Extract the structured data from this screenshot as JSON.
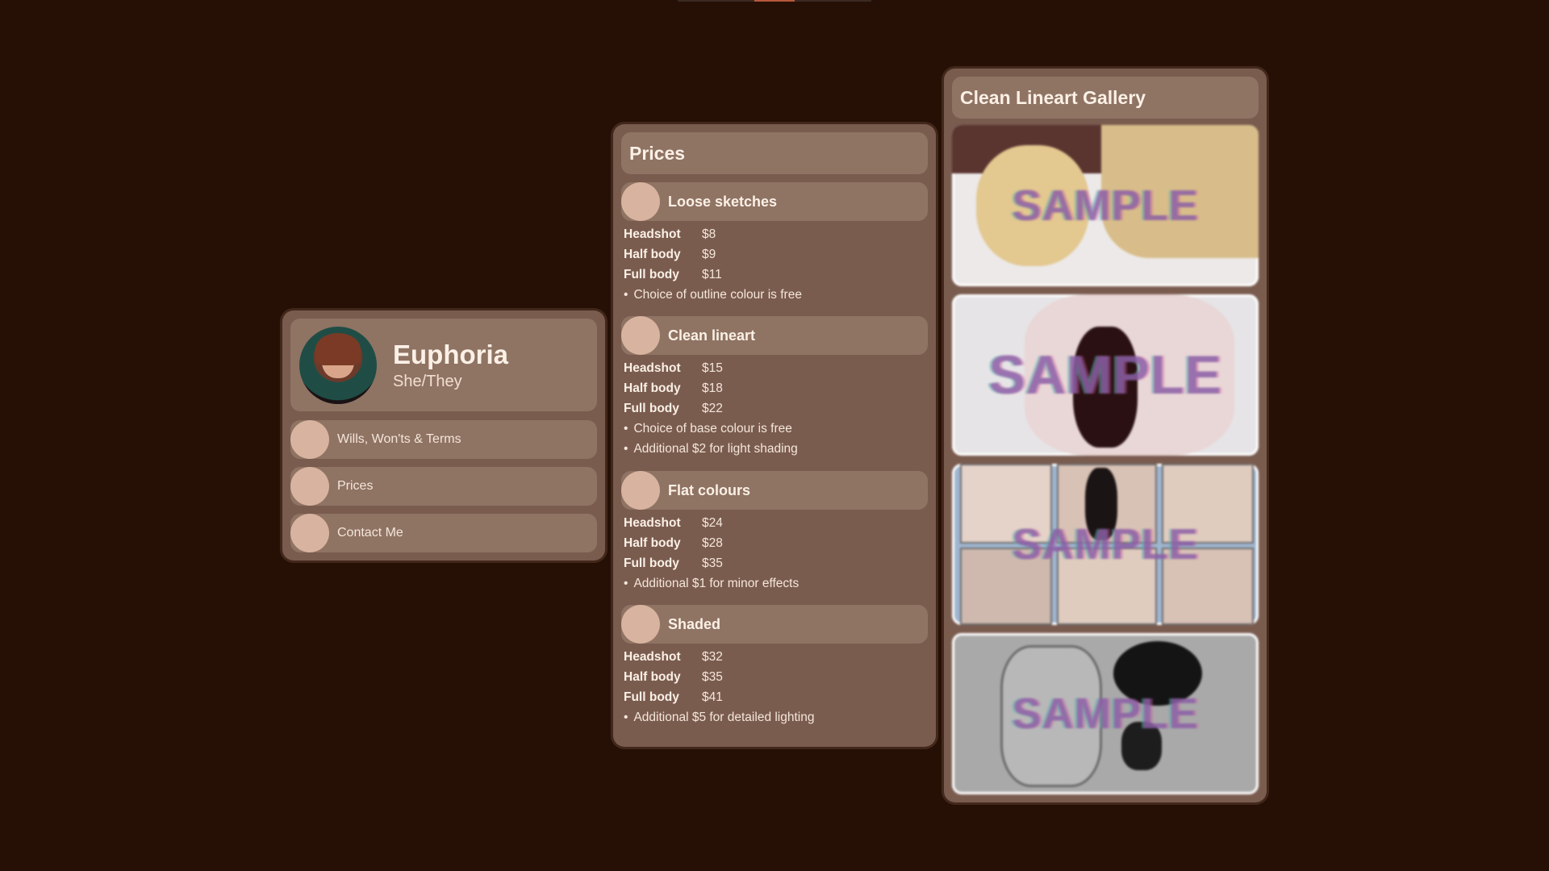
{
  "profile": {
    "name": "Euphoria",
    "pronouns": "She/They",
    "nav": [
      {
        "label": "Wills, Won'ts & Terms"
      },
      {
        "label": "Prices"
      },
      {
        "label": "Contact Me"
      }
    ]
  },
  "prices": {
    "title": "Prices",
    "sections": [
      {
        "name": "Loose sketches",
        "rows": [
          {
            "label": "Headshot",
            "price": "$8"
          },
          {
            "label": "Half body",
            "price": "$9"
          },
          {
            "label": "Full body",
            "price": "$11"
          }
        ],
        "notes": [
          "Choice of outline colour is free"
        ]
      },
      {
        "name": "Clean lineart",
        "rows": [
          {
            "label": "Headshot",
            "price": "$15"
          },
          {
            "label": "Half body",
            "price": "$18"
          },
          {
            "label": "Full body",
            "price": "$22"
          }
        ],
        "notes": [
          "Choice of base colour is free",
          "Additional $2 for light shading"
        ]
      },
      {
        "name": "Flat colours",
        "rows": [
          {
            "label": "Headshot",
            "price": "$24"
          },
          {
            "label": "Half body",
            "price": "$28"
          },
          {
            "label": "Full body",
            "price": "$35"
          }
        ],
        "notes": [
          "Additional $1 for minor effects"
        ]
      },
      {
        "name": "Shaded",
        "rows": [
          {
            "label": "Headshot",
            "price": "$32"
          },
          {
            "label": "Half body",
            "price": "$35"
          },
          {
            "label": "Full body",
            "price": "$41"
          }
        ],
        "notes": [
          "Additional $5 for detailed lighting"
        ]
      }
    ]
  },
  "gallery": {
    "title": "Clean Lineart Gallery",
    "watermark": "SAMPLE",
    "images": [
      {
        "name": "sample-image-1"
      },
      {
        "name": "sample-image-2"
      },
      {
        "name": "sample-image-3"
      },
      {
        "name": "sample-image-4"
      }
    ]
  },
  "colors": {
    "background": "#261006",
    "panel": "#7a5c4f",
    "tile": "#8f7363",
    "dot": "#d8b39f",
    "accent": "#b6583c"
  }
}
